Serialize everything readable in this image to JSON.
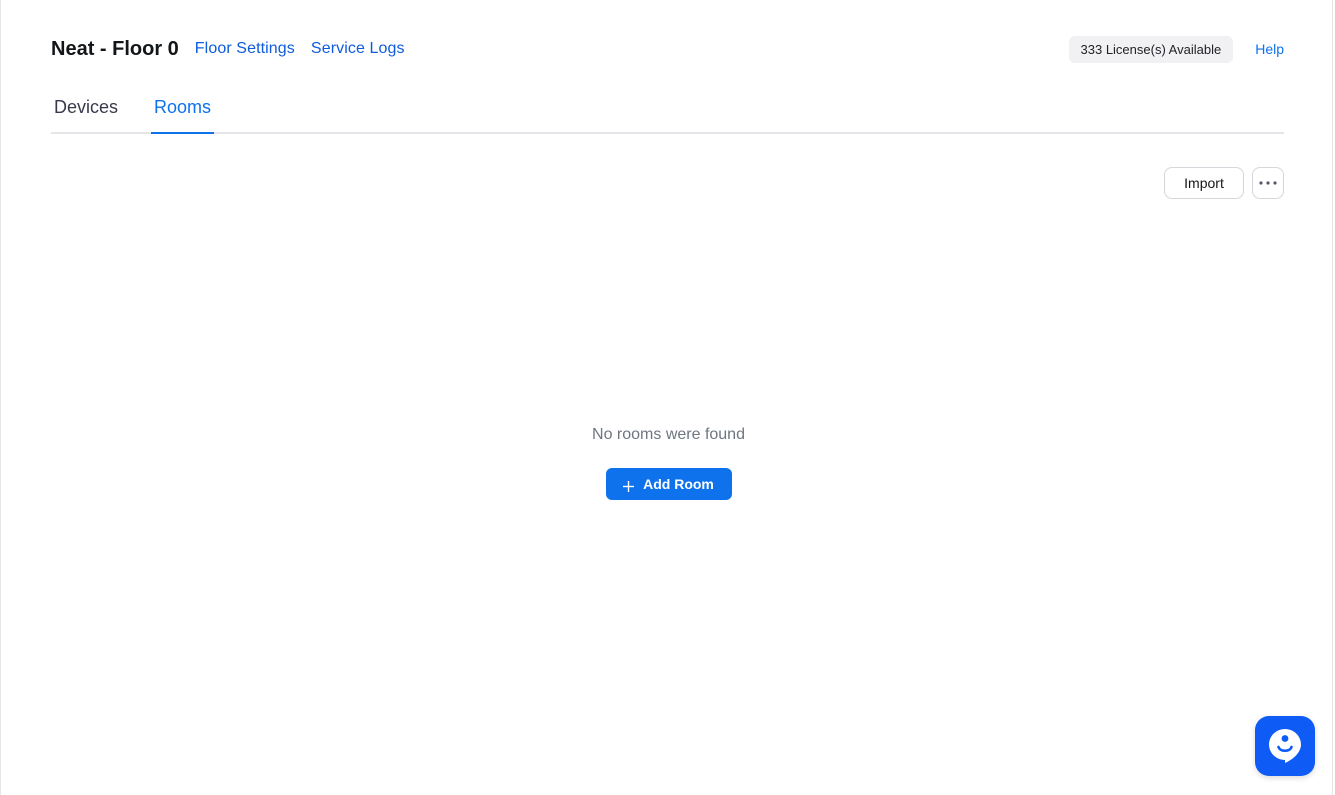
{
  "header": {
    "title": "Neat - Floor 0",
    "floor_settings_label": "Floor Settings",
    "service_logs_label": "Service Logs",
    "license_badge": "333 License(s) Available",
    "help_label": "Help"
  },
  "tabs": [
    {
      "label": "Devices",
      "active": false
    },
    {
      "label": "Rooms",
      "active": true
    }
  ],
  "toolbar": {
    "import_label": "Import",
    "more_icon": "ellipsis-icon"
  },
  "empty_state": {
    "message": "No rooms were found",
    "add_room_label": "Add Room",
    "add_icon": "plus-icon"
  },
  "chat": {
    "icon": "chat-bot-icon"
  },
  "colors": {
    "accent": "#0e72ed",
    "link": "#0e5bdb",
    "fab": "#0e5bf5"
  }
}
